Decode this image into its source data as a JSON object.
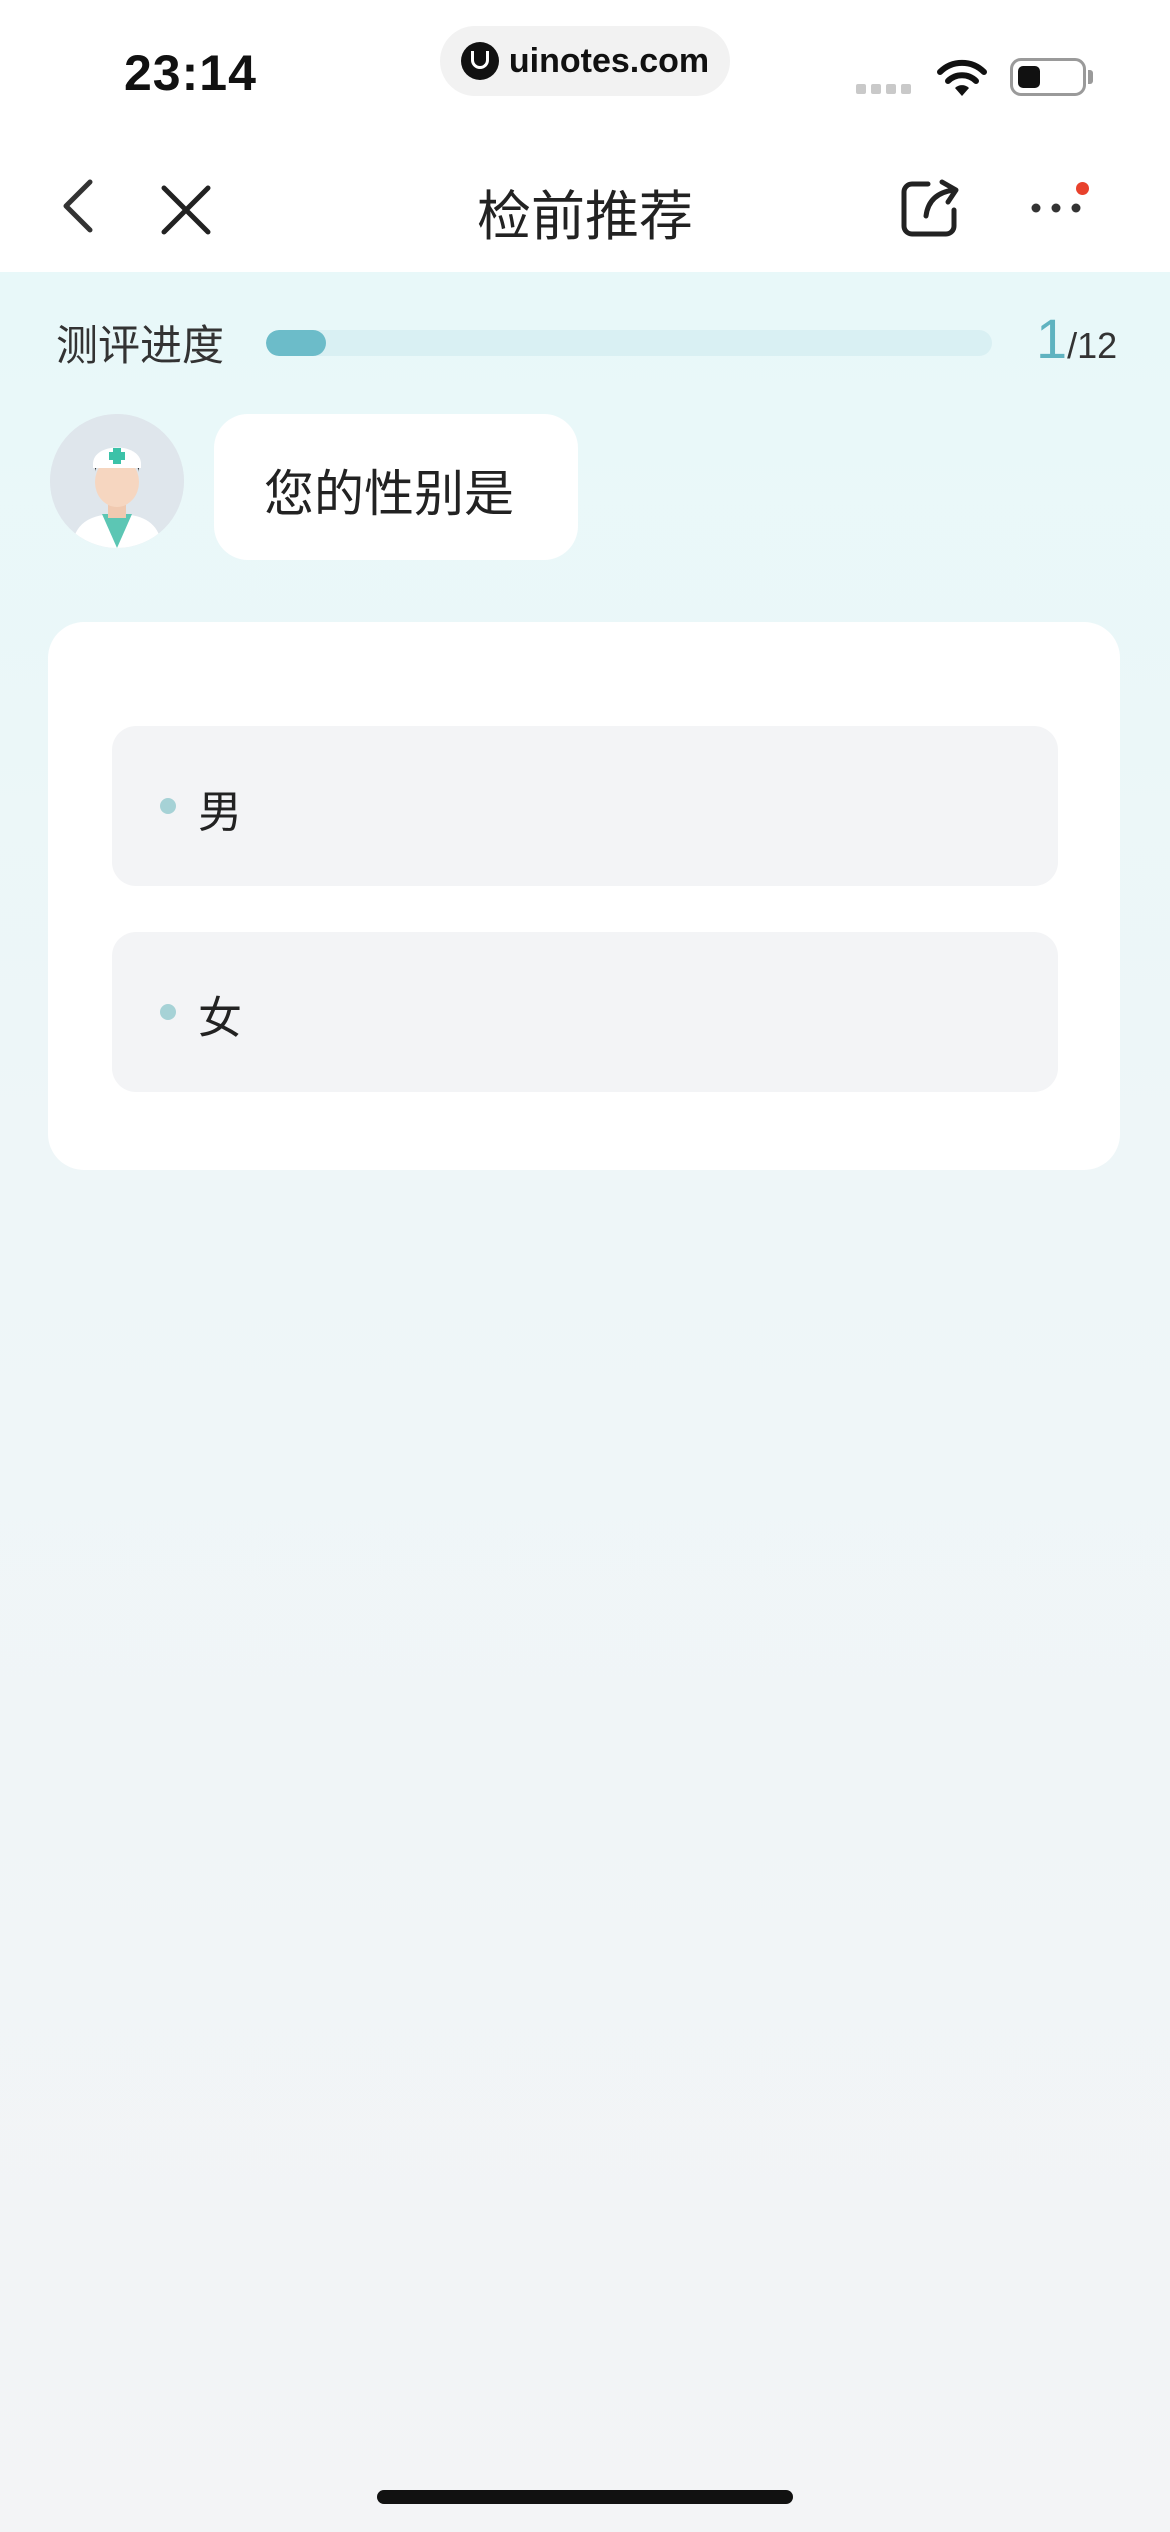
{
  "status_bar": {
    "time": "23:14",
    "url": "uinotes.com",
    "battery_level": 0.35
  },
  "nav": {
    "title": "检前推荐",
    "icons": [
      "back-icon",
      "close-icon",
      "share-icon",
      "more-icon"
    ],
    "notification_dot_color": "#e8412c"
  },
  "progress": {
    "label": "测评进度",
    "current": "1",
    "total": "/12",
    "fraction": 0.083,
    "fill_color": "#6cbcc9"
  },
  "question": {
    "text": "您的性别是"
  },
  "options": [
    {
      "label": "男"
    },
    {
      "label": "女"
    }
  ]
}
